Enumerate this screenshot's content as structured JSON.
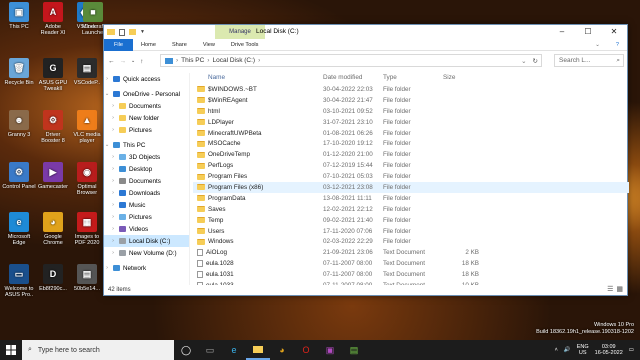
{
  "desktop": {
    "icons": [
      {
        "label": "This PC",
        "color": "#3d8fd6",
        "glyph": "▣"
      },
      {
        "label": "Adobe Reader XI",
        "color": "#c4161c",
        "glyph": "A"
      },
      {
        "label": "VSCode",
        "color": "#1e79c8",
        "glyph": "❮❯"
      },
      {
        "label": "Minecraft Launcher",
        "color": "#5a8a3a",
        "glyph": "■"
      },
      {
        "label": "Recycle Bin",
        "color": "#6aa6d8",
        "glyph": "🗑"
      },
      {
        "label": "ASUS GPU TweakII",
        "color": "#222",
        "glyph": "G"
      },
      {
        "label": "VSCodeP..",
        "color": "#2c2c2c",
        "glyph": "▤"
      },
      {
        "label": "Granny 3",
        "color": "#8a6a4a",
        "glyph": "☻"
      },
      {
        "label": "Driver Booster 8",
        "color": "#c0341d",
        "glyph": "⚙"
      },
      {
        "label": "VLC media player",
        "color": "#ee7d1a",
        "glyph": "▲"
      },
      {
        "label": "Control Panel",
        "color": "#3a7ac8",
        "glyph": "⚙"
      },
      {
        "label": "Gamecaster",
        "color": "#7a3aa8",
        "glyph": "▶"
      },
      {
        "label": "Optimal Browser",
        "color": "#b81d1d",
        "glyph": "◉"
      },
      {
        "label": "Microsoft Edge",
        "color": "#1e8ad6",
        "glyph": "e"
      },
      {
        "label": "Google Chrome",
        "color": "#e0a21b",
        "glyph": "◕"
      },
      {
        "label": "Images to PDF 2020",
        "color": "#c41b1b",
        "glyph": "▦"
      },
      {
        "label": "Welcome to ASUS Pro..",
        "color": "#1a4f8c",
        "glyph": "▭"
      },
      {
        "label": "Eb8f290c...",
        "color": "#222",
        "glyph": "D"
      },
      {
        "label": "50b5e14...",
        "color": "#555",
        "glyph": "▤"
      }
    ]
  },
  "window": {
    "title": "Local Disk (C:)",
    "manage": "Manage",
    "ribbon_tabs": [
      "File",
      "Home",
      "Share",
      "View",
      "Drive Tools"
    ],
    "breadcrumb": [
      "This PC",
      "Local Disk (C:)"
    ],
    "search_placeholder": "Search L...",
    "columns": [
      "Name",
      "Date modified",
      "Type",
      "Size"
    ],
    "nav": [
      {
        "label": "Quick access",
        "icon": "#2b78d4",
        "indent": 0
      },
      {
        "label": "OneDrive - Personal",
        "icon": "#2b78d4",
        "indent": 0
      },
      {
        "label": "Documents",
        "icon": "#f6cd57",
        "indent": 1
      },
      {
        "label": "New folder",
        "icon": "#f6cd57",
        "indent": 1
      },
      {
        "label": "Pictures",
        "icon": "#f6cd57",
        "indent": 1
      },
      {
        "label": "This PC",
        "icon": "#3d8fd6",
        "indent": 0
      },
      {
        "label": "3D Objects",
        "icon": "#6ab0e6",
        "indent": 1
      },
      {
        "label": "Desktop",
        "icon": "#3d8fd6",
        "indent": 1
      },
      {
        "label": "Documents",
        "icon": "#8a8a8a",
        "indent": 1
      },
      {
        "label": "Downloads",
        "icon": "#2b78d4",
        "indent": 1
      },
      {
        "label": "Music",
        "icon": "#2b78d4",
        "indent": 1
      },
      {
        "label": "Pictures",
        "icon": "#6ab0e6",
        "indent": 1
      },
      {
        "label": "Videos",
        "icon": "#7a5ab8",
        "indent": 1
      },
      {
        "label": "Local Disk (C:)",
        "icon": "#9aa0a6",
        "indent": 1,
        "selected": true
      },
      {
        "label": "New Volume (D:)",
        "icon": "#9aa0a6",
        "indent": 1
      },
      {
        "label": "Network",
        "icon": "#3d8fd6",
        "indent": 0
      }
    ],
    "files": [
      {
        "name": "$WINDOWS.~BT",
        "date": "30-04-2022 22:03",
        "type": "File folder",
        "size": "",
        "kind": "folder"
      },
      {
        "name": "$WinREAgent",
        "date": "30-04-2022 21:47",
        "type": "File folder",
        "size": "",
        "kind": "folder"
      },
      {
        "name": "html",
        "date": "03-10-2021 09:52",
        "type": "File folder",
        "size": "",
        "kind": "folder"
      },
      {
        "name": "LDPlayer",
        "date": "31-07-2021 23:10",
        "type": "File folder",
        "size": "",
        "kind": "folder"
      },
      {
        "name": "MinecraftUWPBeta",
        "date": "01-08-2021 06:26",
        "type": "File folder",
        "size": "",
        "kind": "folder"
      },
      {
        "name": "MSOCache",
        "date": "17-10-2020 19:12",
        "type": "File folder",
        "size": "",
        "kind": "folder"
      },
      {
        "name": "OneDriveTemp",
        "date": "01-12-2020 21:00",
        "type": "File folder",
        "size": "",
        "kind": "folder"
      },
      {
        "name": "PerfLogs",
        "date": "07-12-2019 15:44",
        "type": "File folder",
        "size": "",
        "kind": "folder"
      },
      {
        "name": "Program Files",
        "date": "07-10-2021 05:03",
        "type": "File folder",
        "size": "",
        "kind": "folder"
      },
      {
        "name": "Program Files (x86)",
        "date": "03-12-2021 23:08",
        "type": "File folder",
        "size": "",
        "kind": "folder",
        "selected": true
      },
      {
        "name": "ProgramData",
        "date": "13-08-2021 11:11",
        "type": "File folder",
        "size": "",
        "kind": "folder"
      },
      {
        "name": "Saves",
        "date": "12-02-2021 22:12",
        "type": "File folder",
        "size": "",
        "kind": "folder"
      },
      {
        "name": "Temp",
        "date": "09-02-2021 21:40",
        "type": "File folder",
        "size": "",
        "kind": "folder"
      },
      {
        "name": "Users",
        "date": "17-11-2020 07:06",
        "type": "File folder",
        "size": "",
        "kind": "folder"
      },
      {
        "name": "Windows",
        "date": "02-03-2022 22:29",
        "type": "File folder",
        "size": "",
        "kind": "folder"
      },
      {
        "name": "AiOLog",
        "date": "21-09-2021 23:06",
        "type": "Text Document",
        "size": "2 KB",
        "kind": "doc"
      },
      {
        "name": "eula.1028",
        "date": "07-11-2007 08:00",
        "type": "Text Document",
        "size": "18 KB",
        "kind": "doc"
      },
      {
        "name": "eula.1031",
        "date": "07-11-2007 08:00",
        "type": "Text Document",
        "size": "18 KB",
        "kind": "doc"
      },
      {
        "name": "eula.1033",
        "date": "07-11-2007 08:00",
        "type": "Text Document",
        "size": "10 KB",
        "kind": "doc"
      },
      {
        "name": "eula.1036",
        "date": "07-11-2007 08:00",
        "type": "Text Document",
        "size": "18 KB",
        "kind": "doc"
      },
      {
        "name": "eula.1040",
        "date": "07-11-2007 08:00",
        "type": "Text Document",
        "size": "18 KB",
        "kind": "doc"
      }
    ],
    "status": "42 items"
  },
  "taskbar": {
    "search_placeholder": "Type here to search",
    "lang": "ENG",
    "region": "US",
    "time": "03:09",
    "date": "16-05-2022"
  },
  "watermark": {
    "line1": "Windows 10 Pro",
    "line2": "Build 18362.19h1_release.190318-1202"
  }
}
